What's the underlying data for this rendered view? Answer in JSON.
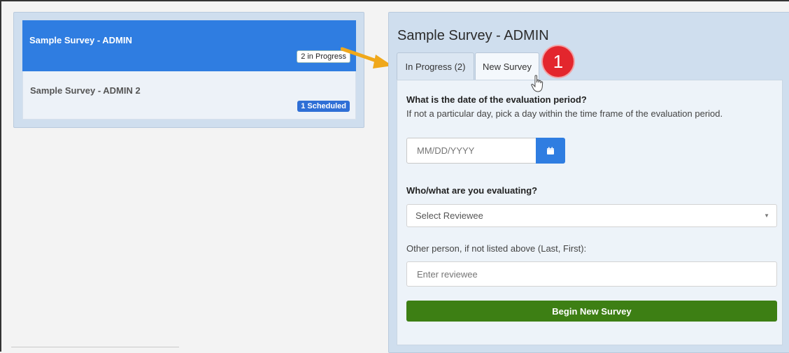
{
  "colors": {
    "accent": "#2f7de1",
    "panel": "#cfdeee",
    "success": "#3d7f14",
    "annotation": "#e3262d",
    "arrow": "#f0a81b"
  },
  "sidebar": {
    "items": [
      {
        "title": "Sample Survey - ADMIN",
        "badge": "2 in Progress"
      },
      {
        "title": "Sample Survey - ADMIN 2",
        "badge": "1 Scheduled"
      }
    ]
  },
  "main": {
    "title": "Sample Survey - ADMIN",
    "tabs": [
      {
        "label": "In Progress (2)"
      },
      {
        "label": "New Survey"
      }
    ],
    "step_marker": "1",
    "form": {
      "date_question": "What is the date of the evaluation period?",
      "date_help": "If not a particular day, pick a day within the time frame of the evaluation period.",
      "date_placeholder": "MM/DD/YYYY",
      "who_question": "Who/what are you evaluating?",
      "select_value": "Select Reviewee",
      "other_label": "Other person, if not listed above (Last, First):",
      "other_placeholder": "Enter reviewee",
      "submit_label": "Begin New Survey"
    }
  }
}
